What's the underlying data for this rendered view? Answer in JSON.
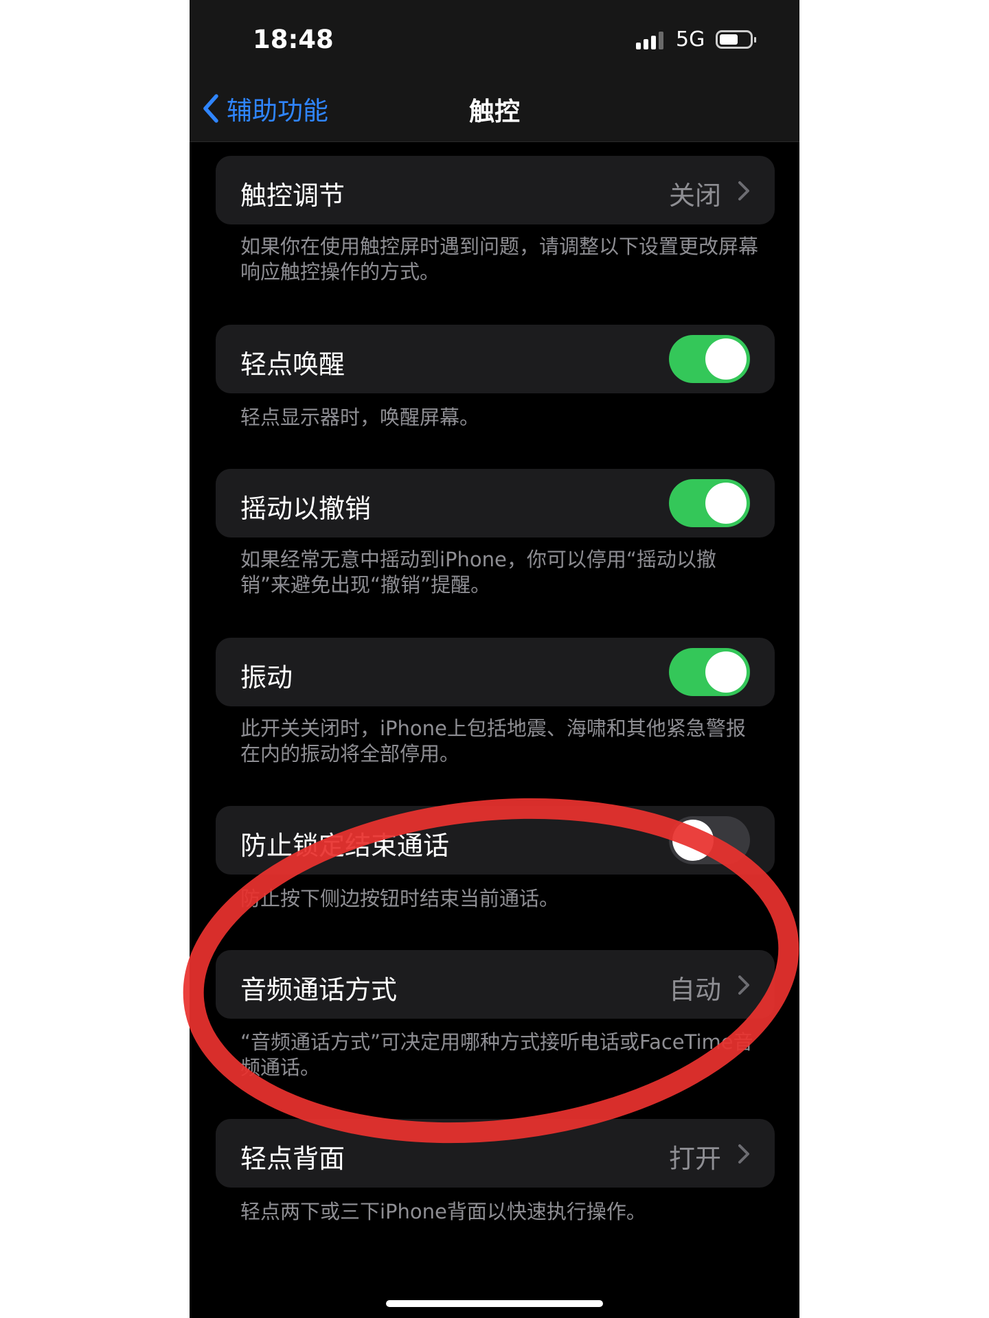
{
  "status_bar": {
    "time": "18:48",
    "network": "5G"
  },
  "nav": {
    "back_label": "辅助功能",
    "title": "触控"
  },
  "settings": [
    {
      "label": "触控调节",
      "value": "关闭",
      "note": "如果你在使用触控屏时遇到问题，请调整以下设置更改屏幕响应触控操作的方式。"
    },
    {
      "label": "轻点唤醒",
      "toggle": "on",
      "note": "轻点显示器时，唤醒屏幕。"
    },
    {
      "label": "摇动以撤销",
      "toggle": "on",
      "note": "如果经常无意中摇动到iPhone，你可以停用“摇动以撤销”来避免出现“撤销”提醒。"
    },
    {
      "label": "振动",
      "toggle": "on",
      "note": "此开关关闭时，iPhone上包括地震、海啸和其他紧急警报在内的振动将全部停用。"
    },
    {
      "label": "防止锁定结束通话",
      "toggle": "off",
      "note": "防止按下侧边按钮时结束当前通话。"
    },
    {
      "label": "音频通话方式",
      "value": "自动",
      "note": "“音频通话方式”可决定用哪种方式接听电话或FaceTime音频通话。"
    },
    {
      "label": "轻点背面",
      "value": "打开",
      "note": "轻点两下或三下iPhone背面以快速执行操作。"
    }
  ],
  "colors": {
    "accent_blue": "#2f85ff",
    "toggle_on": "#34c759",
    "annotation_red": "#e8322e"
  },
  "icons": [
    "back-chevron-icon",
    "chevron-right-icon",
    "signal-icon",
    "battery-icon"
  ]
}
